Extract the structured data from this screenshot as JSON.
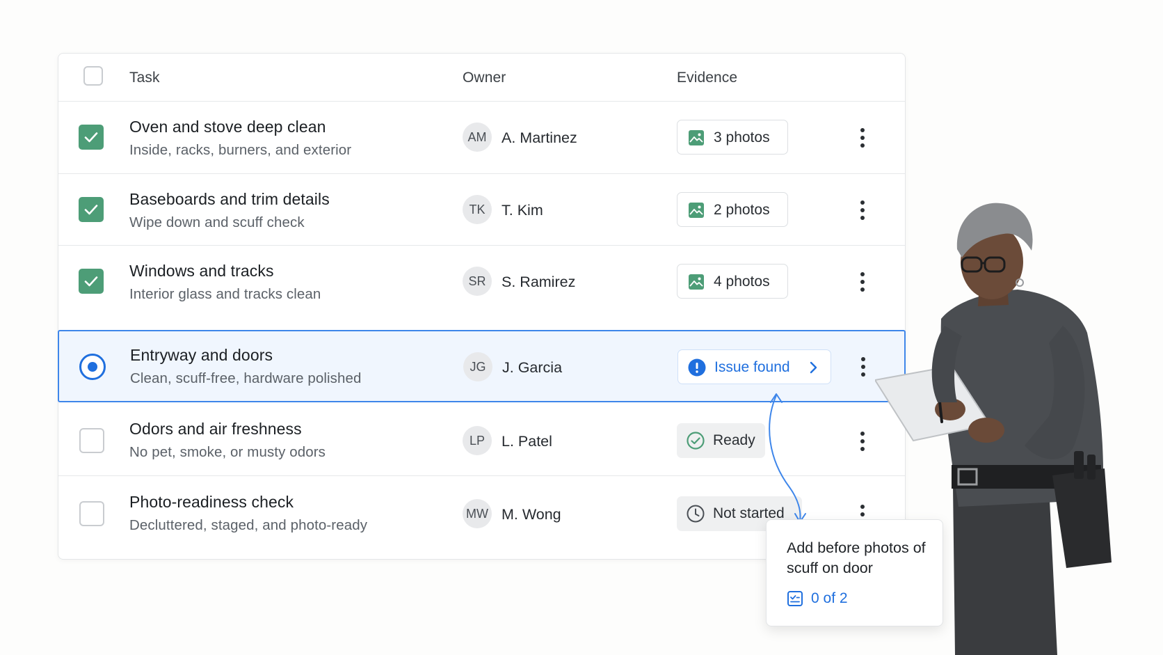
{
  "table": {
    "header": {
      "task": "Task",
      "owner": "Owner",
      "evidence": "Evidence"
    },
    "rows": [
      {
        "title": "Oven and stove deep clean",
        "subtitle": "Inside, racks, burners, and exterior",
        "owner_initials": "AM",
        "owner": "A. Martinez",
        "evidence": "3 photos",
        "status": "checked"
      },
      {
        "title": "Baseboards and trim details",
        "subtitle": "Wipe down and scuff check",
        "owner_initials": "TK",
        "owner": "T. Kim",
        "evidence": "2 photos",
        "status": "checked"
      },
      {
        "title": "Windows and tracks",
        "subtitle": "Interior glass and tracks clean",
        "owner_initials": "SR",
        "owner": "S. Ramirez",
        "evidence": "4 photos",
        "status": "checked"
      },
      {
        "title": "Entryway and doors",
        "subtitle": "Clean, scuff-free, hardware polished",
        "owner_initials": "JG",
        "owner": "J. Garcia",
        "evidence": "Issue found",
        "status": "selected"
      },
      {
        "title": "Odors and air freshness",
        "subtitle": "No pet, smoke, or musty odors",
        "owner_initials": "LP",
        "owner": "L. Patel",
        "evidence": "Ready",
        "status": "unchecked"
      },
      {
        "title": "Photo-readiness check",
        "subtitle": "Decluttered, staged, and photo-ready",
        "owner_initials": "MW",
        "owner": "M. Wong",
        "evidence": "Not started",
        "status": "unchecked"
      }
    ]
  },
  "tooltip": {
    "text": "Add before photos of scuff on door",
    "count": "0 of 2"
  },
  "colors": {
    "accent": "#1f6fde",
    "check_green": "#4d9d77",
    "selected_row_bg": "#f0f6fe"
  }
}
